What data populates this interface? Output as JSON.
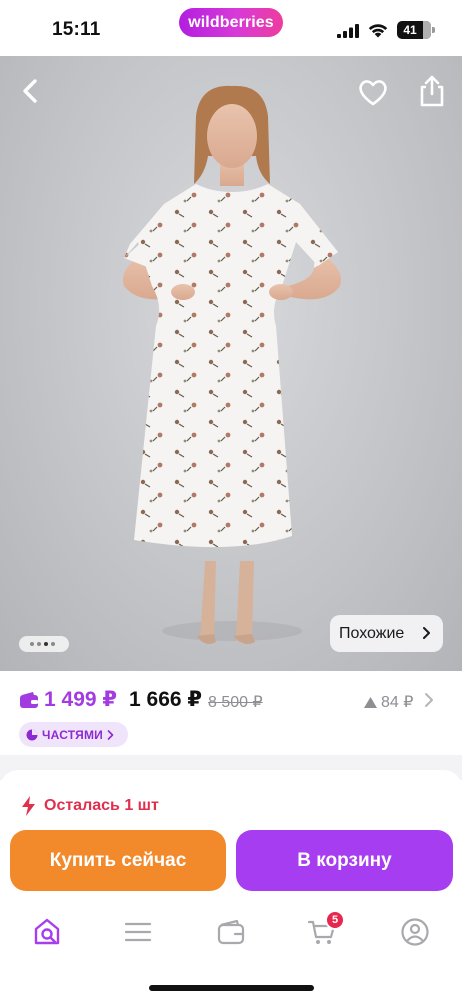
{
  "status_bar": {
    "time": "15:11",
    "brand": "wildberries",
    "battery": "41"
  },
  "product_gallery": {
    "similar_label": "Похожие",
    "dot_count": 4,
    "active_dot": 3,
    "icons": [
      "back-icon",
      "heart-icon",
      "share-icon"
    ]
  },
  "price": {
    "wallet_price": "1 499 ₽",
    "regular_price": "1 666 ₽",
    "old_price": "8 500 ₽",
    "rating_change": "84 ₽",
    "installments_label": "ЧАСТЯМИ"
  },
  "stock": {
    "text": "Осталась 1 шт"
  },
  "actions": {
    "buy_now": "Купить сейчас",
    "to_cart": "В корзину"
  },
  "bottom_nav": {
    "items": [
      "home-search-icon",
      "catalog-icon",
      "wallet-icon",
      "cart-icon",
      "profile-icon"
    ],
    "cart_badge": "5"
  },
  "colors": {
    "brand_purple": "#a73df0",
    "buy_now_orange": "#f28a2c",
    "stock_red": "#e0304e",
    "wallet_price": "#a23be0"
  }
}
